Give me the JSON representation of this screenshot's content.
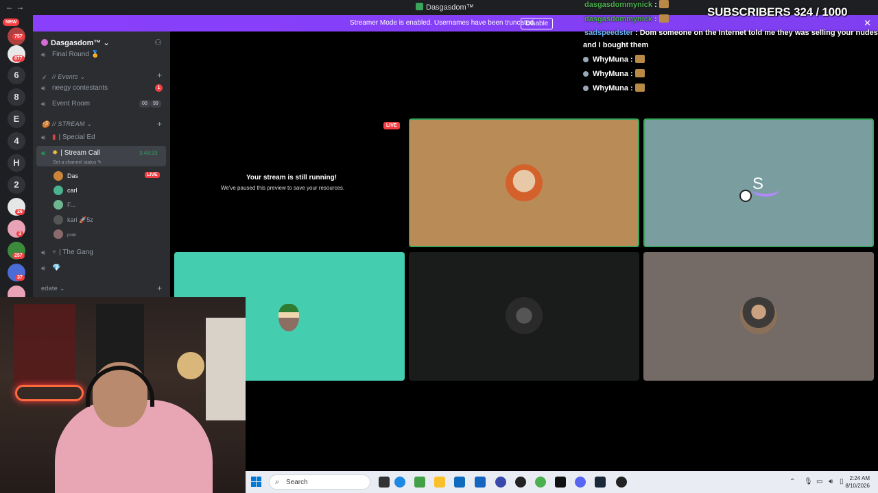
{
  "titlebar": {
    "nav": "←  →",
    "title": "Dasgasdom™"
  },
  "banner": {
    "text": "Streamer Mode is enabled. Usernames have been truncated.",
    "button": "Disable",
    "close": "✕"
  },
  "rail": {
    "new_badge": "NEW",
    "items": [
      {
        "label": "",
        "badge": "757"
      },
      {
        "label": "",
        "badge": "877"
      },
      {
        "label": "6"
      },
      {
        "label": "8"
      },
      {
        "label": "E"
      },
      {
        "label": "4"
      },
      {
        "label": "H"
      },
      {
        "label": "2"
      },
      {
        "label": "",
        "badge": "26"
      },
      {
        "label": "",
        "badge": "3"
      },
      {
        "label": "",
        "badge": "257"
      },
      {
        "label": "",
        "badge": "37"
      },
      {
        "label": "",
        "badge": ""
      }
    ]
  },
  "sidebar": {
    "server_name": "Dasgasdom™ ⌄",
    "final_round": "Final Round 🏅",
    "events_category": "// Events ⌄",
    "neegy": "neegy contestants",
    "neegy_badge": "1",
    "event_room": "Event Room",
    "event_room_counter_a": "00",
    "event_room_counter_b": "99",
    "stream_category": "// STREAM ⌄",
    "special_ed": "Special Ed",
    "stream_call": "Stream Call",
    "stream_call_time": "3:48:33",
    "channel_status": "Set a channel status ✎",
    "users": [
      {
        "name": "Das",
        "live": "LIVE",
        "color": "#c9863b"
      },
      {
        "name": "carl",
        "color": "#4bb18e"
      },
      {
        "name": "F...",
        "color": "#6fb58f"
      },
      {
        "name": "kari  🚀5z",
        "color": "#555"
      },
      {
        "name": "pndn",
        "color": "#8a6a6a"
      }
    ],
    "the_gang": "The Gang",
    "gem_channel": "💎",
    "edate_category": "edate ⌄"
  },
  "stage": {
    "paused_title": "Your stream is still running!",
    "paused_sub": "We've paused this preview to save your resources.",
    "live": "LIVE",
    "tile_s_letter": "S"
  },
  "chat": {
    "messages": [
      {
        "user": "dasgasdommynick",
        "sep": " :"
      },
      {
        "user": "dasgasdommynick",
        "sep": " :"
      },
      {
        "user": "sadspeedster",
        "text": " : Dom someone on the Internet told me they was selling your nudes"
      },
      {
        "continuation": "and I bought them"
      },
      {
        "user": "WhyMuna",
        "sep": " :"
      },
      {
        "user": "WhyMuna",
        "sep": " :"
      },
      {
        "user": "WhyMuna",
        "sep": " :"
      }
    ],
    "subscribers": "SUBSCRIBERS 324 / 1000"
  },
  "taskbar": {
    "search": "Search",
    "time": "2:24 AM",
    "date": "8/10/2026"
  },
  "colors": {
    "accent": "#5865f2",
    "banner": "#7f3ff0",
    "live": "#f23f43",
    "tile_orange": "#b98c57",
    "tile_blue": "#7a9ea0",
    "tile_teal": "#45cdb0",
    "tile_dark": "#1a1c1b",
    "tile_taupe": "#746a66"
  }
}
